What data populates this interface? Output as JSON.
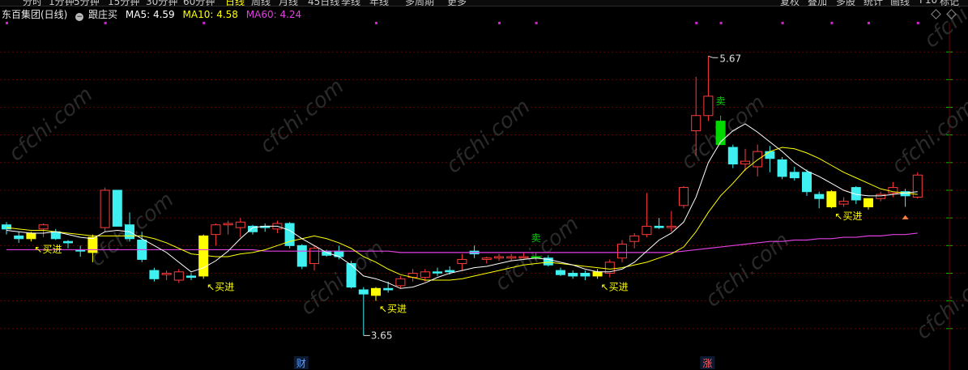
{
  "toolbar": {
    "left_items": [
      "分时",
      "1分钟",
      "5分钟",
      "15分钟",
      "30分钟",
      "60分钟",
      "日线",
      "周线",
      "月线",
      "45日线",
      "季线",
      "年线",
      "多周期",
      "更多"
    ],
    "right_items": [
      "复权",
      "叠加",
      "多股",
      "统计",
      "画线",
      "F10",
      "标记"
    ],
    "active": "日线"
  },
  "header": {
    "title": "东百集团(日线)",
    "indicator": "跟庄买",
    "ma5_label": "MA5:",
    "ma5_value": "4.59",
    "ma10_label": "MA10:",
    "ma10_value": "4.58",
    "ma60_label": "MA60:",
    "ma60_value": "4.24",
    "collapse_icon": "circle-minus-icon",
    "corner_icons": [
      "diamond-outline-icon",
      "diamond-outline-icon"
    ]
  },
  "watermark": "cfchi.com",
  "colors": {
    "background": "#000000",
    "up": "#ff3b3b",
    "down": "#3ff0f0",
    "buy_signal": "#ffff00",
    "sell_signal": "#00d800",
    "ma5": "#ffffff",
    "ma10": "#ffff00",
    "ma60": "#e040e0",
    "gridline": "#7a0000",
    "text": "#dddddd"
  },
  "annotations": {
    "buy_labels": [
      "买进",
      "买进",
      "买进",
      "买进",
      "买进"
    ],
    "sell_labels": [
      "卖",
      "卖"
    ],
    "high_label": "5.67",
    "low_label": "3.65",
    "bottom_markers": [
      "财",
      "涨"
    ]
  },
  "chart_data": {
    "type": "candlestick",
    "title": "东百集团(日线)",
    "ylim": [
      3.5,
      5.9
    ],
    "grid": true,
    "candles": [
      {
        "o": 4.45,
        "h": 4.47,
        "l": 4.38,
        "c": 4.42,
        "signal": "none"
      },
      {
        "o": 4.35,
        "h": 4.4,
        "l": 4.32,
        "c": 4.37,
        "signal": "down"
      },
      {
        "o": 4.35,
        "h": 4.4,
        "l": 4.33,
        "c": 4.39,
        "signal": "buy"
      },
      {
        "o": 4.42,
        "h": 4.46,
        "l": 4.36,
        "c": 4.45,
        "signal": "none"
      },
      {
        "o": 4.4,
        "h": 4.42,
        "l": 4.34,
        "c": 4.35,
        "signal": "down"
      },
      {
        "o": 4.33,
        "h": 4.34,
        "l": 4.28,
        "c": 4.32,
        "signal": "down"
      },
      {
        "o": 4.27,
        "h": 4.3,
        "l": 4.22,
        "c": 4.26,
        "signal": "down"
      },
      {
        "o": 4.25,
        "h": 4.38,
        "l": 4.18,
        "c": 4.36,
        "signal": "buy"
      },
      {
        "o": 4.43,
        "h": 4.72,
        "l": 4.4,
        "c": 4.7,
        "signal": "none"
      },
      {
        "o": 4.7,
        "h": 4.7,
        "l": 4.44,
        "c": 4.44,
        "signal": "down"
      },
      {
        "o": 4.45,
        "h": 4.54,
        "l": 4.33,
        "c": 4.35,
        "signal": "down"
      },
      {
        "o": 4.34,
        "h": 4.4,
        "l": 4.18,
        "c": 4.2,
        "signal": "down"
      },
      {
        "o": 4.12,
        "h": 4.14,
        "l": 4.04,
        "c": 4.06,
        "signal": "down"
      },
      {
        "o": 4.09,
        "h": 4.12,
        "l": 4.05,
        "c": 4.1,
        "signal": "none"
      },
      {
        "o": 4.05,
        "h": 4.13,
        "l": 4.03,
        "c": 4.11,
        "signal": "none"
      },
      {
        "o": 4.07,
        "h": 4.1,
        "l": 4.05,
        "c": 4.08,
        "signal": "down"
      },
      {
        "o": 4.08,
        "h": 4.38,
        "l": 4.06,
        "c": 4.37,
        "signal": "buy"
      },
      {
        "o": 4.38,
        "h": 4.46,
        "l": 4.3,
        "c": 4.45,
        "signal": "none"
      },
      {
        "o": 4.45,
        "h": 4.48,
        "l": 4.38,
        "c": 4.46,
        "signal": "none"
      },
      {
        "o": 4.43,
        "h": 4.5,
        "l": 4.36,
        "c": 4.47,
        "signal": "none"
      },
      {
        "o": 4.44,
        "h": 4.45,
        "l": 4.38,
        "c": 4.4,
        "signal": "down"
      },
      {
        "o": 4.43,
        "h": 4.46,
        "l": 4.4,
        "c": 4.44,
        "signal": "down"
      },
      {
        "o": 4.42,
        "h": 4.48,
        "l": 4.39,
        "c": 4.46,
        "signal": "none"
      },
      {
        "o": 4.46,
        "h": 4.47,
        "l": 4.28,
        "c": 4.3,
        "signal": "down"
      },
      {
        "o": 4.3,
        "h": 4.31,
        "l": 4.13,
        "c": 4.15,
        "signal": "down"
      },
      {
        "o": 4.17,
        "h": 4.3,
        "l": 4.12,
        "c": 4.28,
        "signal": "none"
      },
      {
        "o": 4.26,
        "h": 4.27,
        "l": 4.22,
        "c": 4.23,
        "signal": "none"
      },
      {
        "o": 4.26,
        "h": 4.3,
        "l": 4.2,
        "c": 4.22,
        "signal": "down"
      },
      {
        "o": 4.17,
        "h": 4.19,
        "l": 3.99,
        "c": 4.0,
        "signal": "down"
      },
      {
        "o": 3.98,
        "h": 4.0,
        "l": 3.65,
        "c": 3.95,
        "signal": "down"
      },
      {
        "o": 3.94,
        "h": 4.0,
        "l": 3.9,
        "c": 3.99,
        "signal": "buy"
      },
      {
        "o": 3.98,
        "h": 4.04,
        "l": 3.96,
        "c": 3.99,
        "signal": "down"
      },
      {
        "o": 4.01,
        "h": 4.08,
        "l": 3.99,
        "c": 4.06,
        "signal": "none"
      },
      {
        "o": 4.07,
        "h": 4.13,
        "l": 4.04,
        "c": 4.1,
        "signal": "none"
      },
      {
        "o": 4.07,
        "h": 4.13,
        "l": 4.04,
        "c": 4.11,
        "signal": "none"
      },
      {
        "o": 4.11,
        "h": 4.14,
        "l": 4.08,
        "c": 4.11,
        "signal": "down"
      },
      {
        "o": 4.11,
        "h": 4.15,
        "l": 4.09,
        "c": 4.12,
        "signal": "down"
      },
      {
        "o": 4.17,
        "h": 4.24,
        "l": 4.12,
        "c": 4.2,
        "signal": "none"
      },
      {
        "o": 4.26,
        "h": 4.3,
        "l": 4.21,
        "c": 4.24,
        "signal": "down"
      },
      {
        "o": 4.2,
        "h": 4.22,
        "l": 4.17,
        "c": 4.21,
        "signal": "none"
      },
      {
        "o": 4.21,
        "h": 4.24,
        "l": 4.19,
        "c": 4.22,
        "signal": "none"
      },
      {
        "o": 4.21,
        "h": 4.24,
        "l": 4.19,
        "c": 4.22,
        "signal": "none"
      },
      {
        "o": 4.22,
        "h": 4.25,
        "l": 4.21,
        "c": 4.22,
        "signal": "none"
      },
      {
        "o": 4.22,
        "h": 4.25,
        "l": 4.2,
        "c": 4.21,
        "signal": "sell"
      },
      {
        "o": 4.21,
        "h": 4.23,
        "l": 4.15,
        "c": 4.16,
        "signal": "down"
      },
      {
        "o": 4.12,
        "h": 4.14,
        "l": 4.08,
        "c": 4.09,
        "signal": "down"
      },
      {
        "o": 4.1,
        "h": 4.12,
        "l": 4.06,
        "c": 4.08,
        "signal": "down"
      },
      {
        "o": 4.1,
        "h": 4.12,
        "l": 4.05,
        "c": 4.08,
        "signal": "down"
      },
      {
        "o": 4.08,
        "h": 4.13,
        "l": 4.06,
        "c": 4.11,
        "signal": "buy"
      },
      {
        "o": 4.1,
        "h": 4.2,
        "l": 4.07,
        "c": 4.18,
        "signal": "none"
      },
      {
        "o": 4.21,
        "h": 4.34,
        "l": 4.18,
        "c": 4.31,
        "signal": "none"
      },
      {
        "o": 4.33,
        "h": 4.39,
        "l": 4.28,
        "c": 4.37,
        "signal": "none"
      },
      {
        "o": 4.38,
        "h": 4.68,
        "l": 4.36,
        "c": 4.44,
        "signal": "none"
      },
      {
        "o": 4.44,
        "h": 4.5,
        "l": 4.42,
        "c": 4.43,
        "signal": "down"
      },
      {
        "o": 4.43,
        "h": 4.55,
        "l": 4.4,
        "c": 4.44,
        "signal": "none"
      },
      {
        "o": 4.59,
        "h": 4.73,
        "l": 4.57,
        "c": 4.72,
        "signal": "none"
      },
      {
        "o": 5.13,
        "h": 5.52,
        "l": 4.95,
        "c": 5.24,
        "signal": "none"
      },
      {
        "o": 5.24,
        "h": 5.67,
        "l": 5.2,
        "c": 5.38,
        "signal": "none"
      },
      {
        "o": 5.2,
        "h": 5.24,
        "l": 5.03,
        "c": 5.03,
        "signal": "sell"
      },
      {
        "o": 5.01,
        "h": 5.03,
        "l": 4.86,
        "c": 4.89,
        "signal": "down"
      },
      {
        "o": 4.89,
        "h": 5.0,
        "l": 4.84,
        "c": 4.91,
        "signal": "none"
      },
      {
        "o": 4.87,
        "h": 5.03,
        "l": 4.8,
        "c": 4.98,
        "signal": "none"
      },
      {
        "o": 4.98,
        "h": 5.02,
        "l": 4.83,
        "c": 4.93,
        "signal": "down"
      },
      {
        "o": 4.92,
        "h": 4.94,
        "l": 4.78,
        "c": 4.8,
        "signal": "none"
      },
      {
        "o": 4.83,
        "h": 4.87,
        "l": 4.77,
        "c": 4.79,
        "signal": "down"
      },
      {
        "o": 4.83,
        "h": 4.85,
        "l": 4.66,
        "c": 4.69,
        "signal": "down"
      },
      {
        "o": 4.67,
        "h": 4.69,
        "l": 4.57,
        "c": 4.64,
        "signal": "down"
      },
      {
        "o": 4.58,
        "h": 4.7,
        "l": 4.57,
        "c": 4.69,
        "signal": "buy"
      },
      {
        "o": 4.6,
        "h": 4.65,
        "l": 4.58,
        "c": 4.62,
        "signal": "none"
      },
      {
        "o": 4.72,
        "h": 4.73,
        "l": 4.6,
        "c": 4.63,
        "signal": "down"
      },
      {
        "o": 4.58,
        "h": 4.64,
        "l": 4.56,
        "c": 4.64,
        "signal": "buy"
      },
      {
        "o": 4.64,
        "h": 4.69,
        "l": 4.62,
        "c": 4.67,
        "signal": "none"
      },
      {
        "o": 4.68,
        "h": 4.76,
        "l": 4.65,
        "c": 4.72,
        "signal": "none"
      },
      {
        "o": 4.69,
        "h": 4.71,
        "l": 4.58,
        "c": 4.66,
        "signal": "down"
      },
      {
        "o": 4.65,
        "h": 4.83,
        "l": 4.64,
        "c": 4.81,
        "signal": "none"
      }
    ],
    "ma5": [
      4.41,
      4.4,
      4.39,
      4.39,
      4.4,
      4.38,
      4.36,
      4.35,
      4.4,
      4.41,
      4.4,
      4.35,
      4.3,
      4.25,
      4.18,
      4.11,
      4.14,
      4.19,
      4.26,
      4.35,
      4.43,
      4.44,
      4.44,
      4.41,
      4.35,
      4.3,
      4.25,
      4.22,
      4.16,
      4.08,
      4.06,
      4.03,
      3.99,
      4.0,
      4.03,
      4.07,
      4.1,
      4.12,
      4.14,
      4.15,
      4.17,
      4.19,
      4.2,
      4.21,
      4.2,
      4.18,
      4.16,
      4.13,
      4.11,
      4.11,
      4.13,
      4.18,
      4.26,
      4.34,
      4.39,
      4.47,
      4.65,
      4.9,
      5.05,
      5.13,
      5.18,
      5.12,
      5.05,
      4.98,
      4.9,
      4.84,
      4.8,
      4.75,
      4.7,
      4.67,
      4.66,
      4.66,
      4.67,
      4.68,
      4.69
    ],
    "ma10": [
      4.43,
      4.42,
      4.41,
      4.41,
      4.4,
      4.39,
      4.38,
      4.37,
      4.37,
      4.37,
      4.37,
      4.37,
      4.35,
      4.32,
      4.28,
      4.24,
      4.23,
      4.22,
      4.22,
      4.24,
      4.25,
      4.27,
      4.3,
      4.33,
      4.35,
      4.37,
      4.35,
      4.32,
      4.28,
      4.22,
      4.18,
      4.13,
      4.09,
      4.07,
      4.05,
      4.05,
      4.05,
      4.06,
      4.08,
      4.1,
      4.12,
      4.14,
      4.16,
      4.17,
      4.18,
      4.17,
      4.16,
      4.15,
      4.14,
      4.13,
      4.14,
      4.16,
      4.18,
      4.21,
      4.24,
      4.29,
      4.4,
      4.54,
      4.66,
      4.75,
      4.85,
      4.92,
      4.98,
      5.01,
      5.0,
      4.97,
      4.93,
      4.88,
      4.83,
      4.79,
      4.75,
      4.71,
      4.69,
      4.68,
      4.67
    ],
    "ma60": [
      4.27,
      4.27,
      4.27,
      4.27,
      4.27,
      4.27,
      4.27,
      4.27,
      4.27,
      4.27,
      4.27,
      4.27,
      4.27,
      4.27,
      4.27,
      4.27,
      4.27,
      4.27,
      4.27,
      4.27,
      4.27,
      4.26,
      4.26,
      4.26,
      4.26,
      4.26,
      4.26,
      4.26,
      4.26,
      4.26,
      4.26,
      4.26,
      4.25,
      4.25,
      4.25,
      4.25,
      4.25,
      4.25,
      4.25,
      4.25,
      4.25,
      4.25,
      4.25,
      4.25,
      4.25,
      4.25,
      4.25,
      4.25,
      4.25,
      4.25,
      4.25,
      4.25,
      4.25,
      4.25,
      4.25,
      4.26,
      4.27,
      4.28,
      4.29,
      4.3,
      4.31,
      4.32,
      4.33,
      4.33,
      4.34,
      4.34,
      4.35,
      4.35,
      4.36,
      4.36,
      4.37,
      4.37,
      4.38,
      4.38,
      4.39
    ],
    "buy_signal_indices": [
      2,
      7,
      16,
      30,
      48,
      67,
      70
    ],
    "sell_signal_indices": [
      43,
      58
    ],
    "high": 5.67,
    "low": 3.65
  }
}
